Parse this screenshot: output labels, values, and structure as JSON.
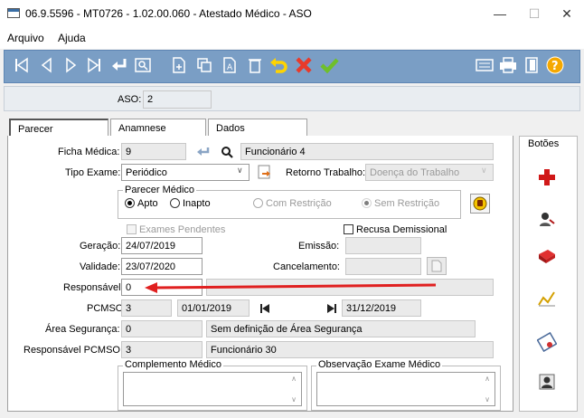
{
  "window": {
    "title": "06.9.5596 - MT0726 - 1.02.00.060 - Atestado Médico - ASO",
    "minimize": "—",
    "maximize": "☐",
    "close": "✕"
  },
  "menu": [
    "Arquivo",
    "Ajuda"
  ],
  "header": {
    "aso_label": "ASO:",
    "aso_value": "2"
  },
  "tabs": [
    "Parecer",
    "Anamnese",
    "Dados"
  ],
  "form": {
    "ficha_label": "Ficha Médica:",
    "ficha_value": "9",
    "ficha_nome": "Funcionário 4",
    "tipo_label": "Tipo Exame:",
    "tipo_value": "Periódico",
    "retorno_label": "Retorno Trabalho:",
    "retorno_value": "Doença do Trabalho",
    "parecer_title": "Parecer Médico",
    "apto": "Apto",
    "inapto": "Inapto",
    "com_restricao": "Com Restrição",
    "sem_restricao": "Sem Restrição",
    "exames_pendentes": "Exames Pendentes",
    "recusa": "Recusa Demissional",
    "geracao_label": "Geração:",
    "geracao_value": "24/07/2019",
    "emissao_label": "Emissão:",
    "emissao_value": "",
    "validade_label": "Validade:",
    "validade_value": "23/07/2020",
    "cancelamento_label": "Cancelamento:",
    "cancelamento_value": "",
    "responsavel_label": "Responsável:",
    "responsavel_value": "0",
    "responsavel_nome": "",
    "pcmso_label": "PCMSO:",
    "pcmso_value": "3",
    "pcmso_inicio": "01/01/2019",
    "pcmso_fim": "31/12/2019",
    "area_label": "Área Segurança:",
    "area_value": "0",
    "area_nome": "Sem definição de Área Segurança",
    "resp_pcmso_label": "Responsável PCMSO:",
    "resp_pcmso_value": "3",
    "resp_pcmso_nome": "Funcionário 30",
    "complemento_title": "Complemento Médico",
    "observacao_title": "Observação Exame Médico"
  },
  "sidebar": {
    "title": "Botões"
  },
  "colors": {
    "toolbar": "#7a9ec5",
    "arrow": "#e02020"
  }
}
